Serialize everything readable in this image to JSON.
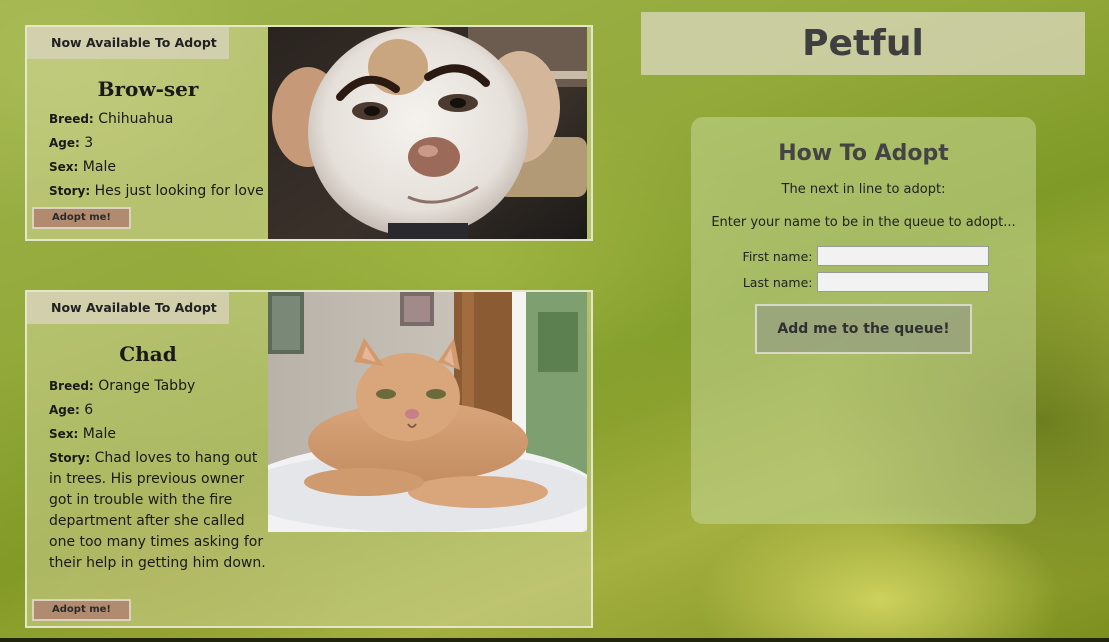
{
  "app": {
    "title": "Petful"
  },
  "pets": [
    {
      "tag": "Now Available To Adopt",
      "name": "Brow-ser",
      "breed_label": "Breed:",
      "breed": "Chihuahua",
      "age_label": "Age:",
      "age": "3",
      "sex_label": "Sex:",
      "sex": "Male",
      "story_label": "Story:",
      "story": "Hes just looking for love",
      "adopt_label": "Adopt me!",
      "photo_icon": "chihuahua-photo"
    },
    {
      "tag": "Now Available To Adopt",
      "name": "Chad",
      "breed_label": "Breed:",
      "breed": "Orange Tabby",
      "age_label": "Age:",
      "age": "6",
      "sex_label": "Sex:",
      "sex": "Male",
      "story_label": "Story:",
      "story": "Chad loves to hang out in trees. His previous owner got in trouble with the fire department after she called one too many times asking for their help in getting him down.",
      "adopt_label": "Adopt me!",
      "photo_icon": "orange-tabby-photo"
    }
  ],
  "adopt_panel": {
    "heading": "How To Adopt",
    "next_in_line": "The next in line to adopt:",
    "instructions": "Enter your name to be in the queue to adopt...",
    "first_name_label": "First name:",
    "first_name_value": "",
    "last_name_label": "Last name:",
    "last_name_value": "",
    "submit_label": "Add me to the queue!"
  }
}
